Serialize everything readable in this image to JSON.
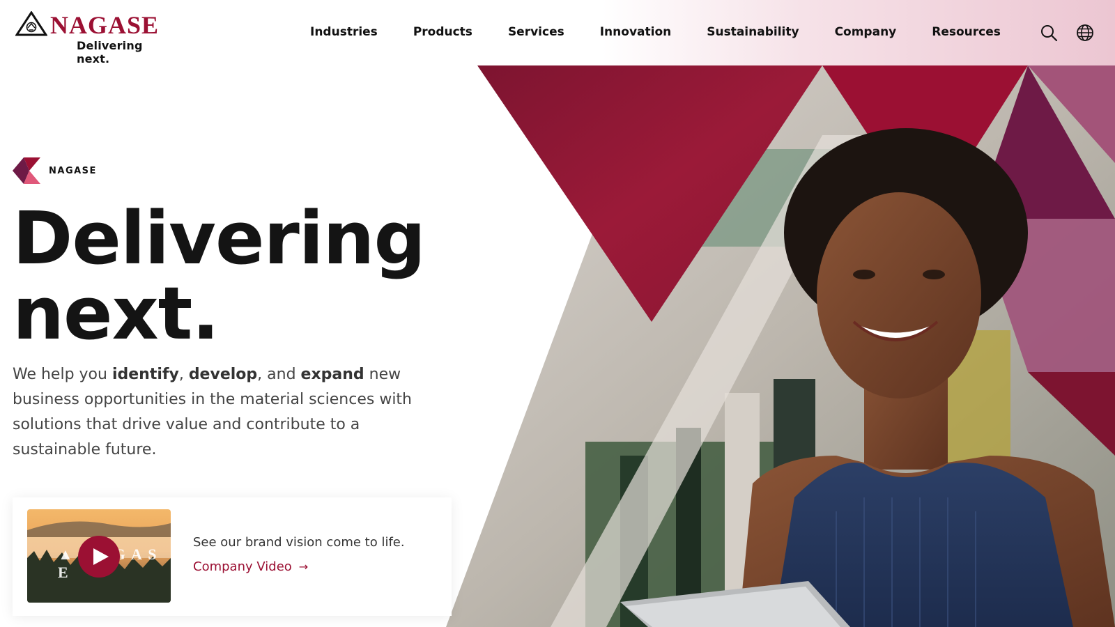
{
  "brand": {
    "name": "NAGASE",
    "tagline": "Delivering next.",
    "primary_color": "#9b1033",
    "accent_colors": [
      "#9b1033",
      "#6e1a3c",
      "#c84b6f",
      "#a0527a"
    ]
  },
  "nav": {
    "items": [
      {
        "label": "Industries"
      },
      {
        "label": "Products"
      },
      {
        "label": "Services"
      },
      {
        "label": "Innovation"
      },
      {
        "label": "Sustainability"
      },
      {
        "label": "Company"
      },
      {
        "label": "Resources"
      }
    ],
    "search_icon": "search-icon",
    "language_icon": "globe-icon"
  },
  "hero": {
    "eyebrow": "NAGASE",
    "headline_line1": "Delivering",
    "headline_line2": "next.",
    "intro_parts": {
      "p1": "We help you ",
      "b1": "identify",
      "p2": ", ",
      "b2": "develop",
      "p3": ", and ",
      "b3": "expand",
      "p4": " new business opportunities in the material sciences with solutions that drive value and contribute to a sustainable future."
    },
    "image_subject": "smiling woman holding a tablet in front of a building with red triangle overlays"
  },
  "video_card": {
    "description": "See our brand vision come to life.",
    "link_label": "Company Video",
    "link_arrow": "→",
    "play_icon": "play-icon"
  }
}
